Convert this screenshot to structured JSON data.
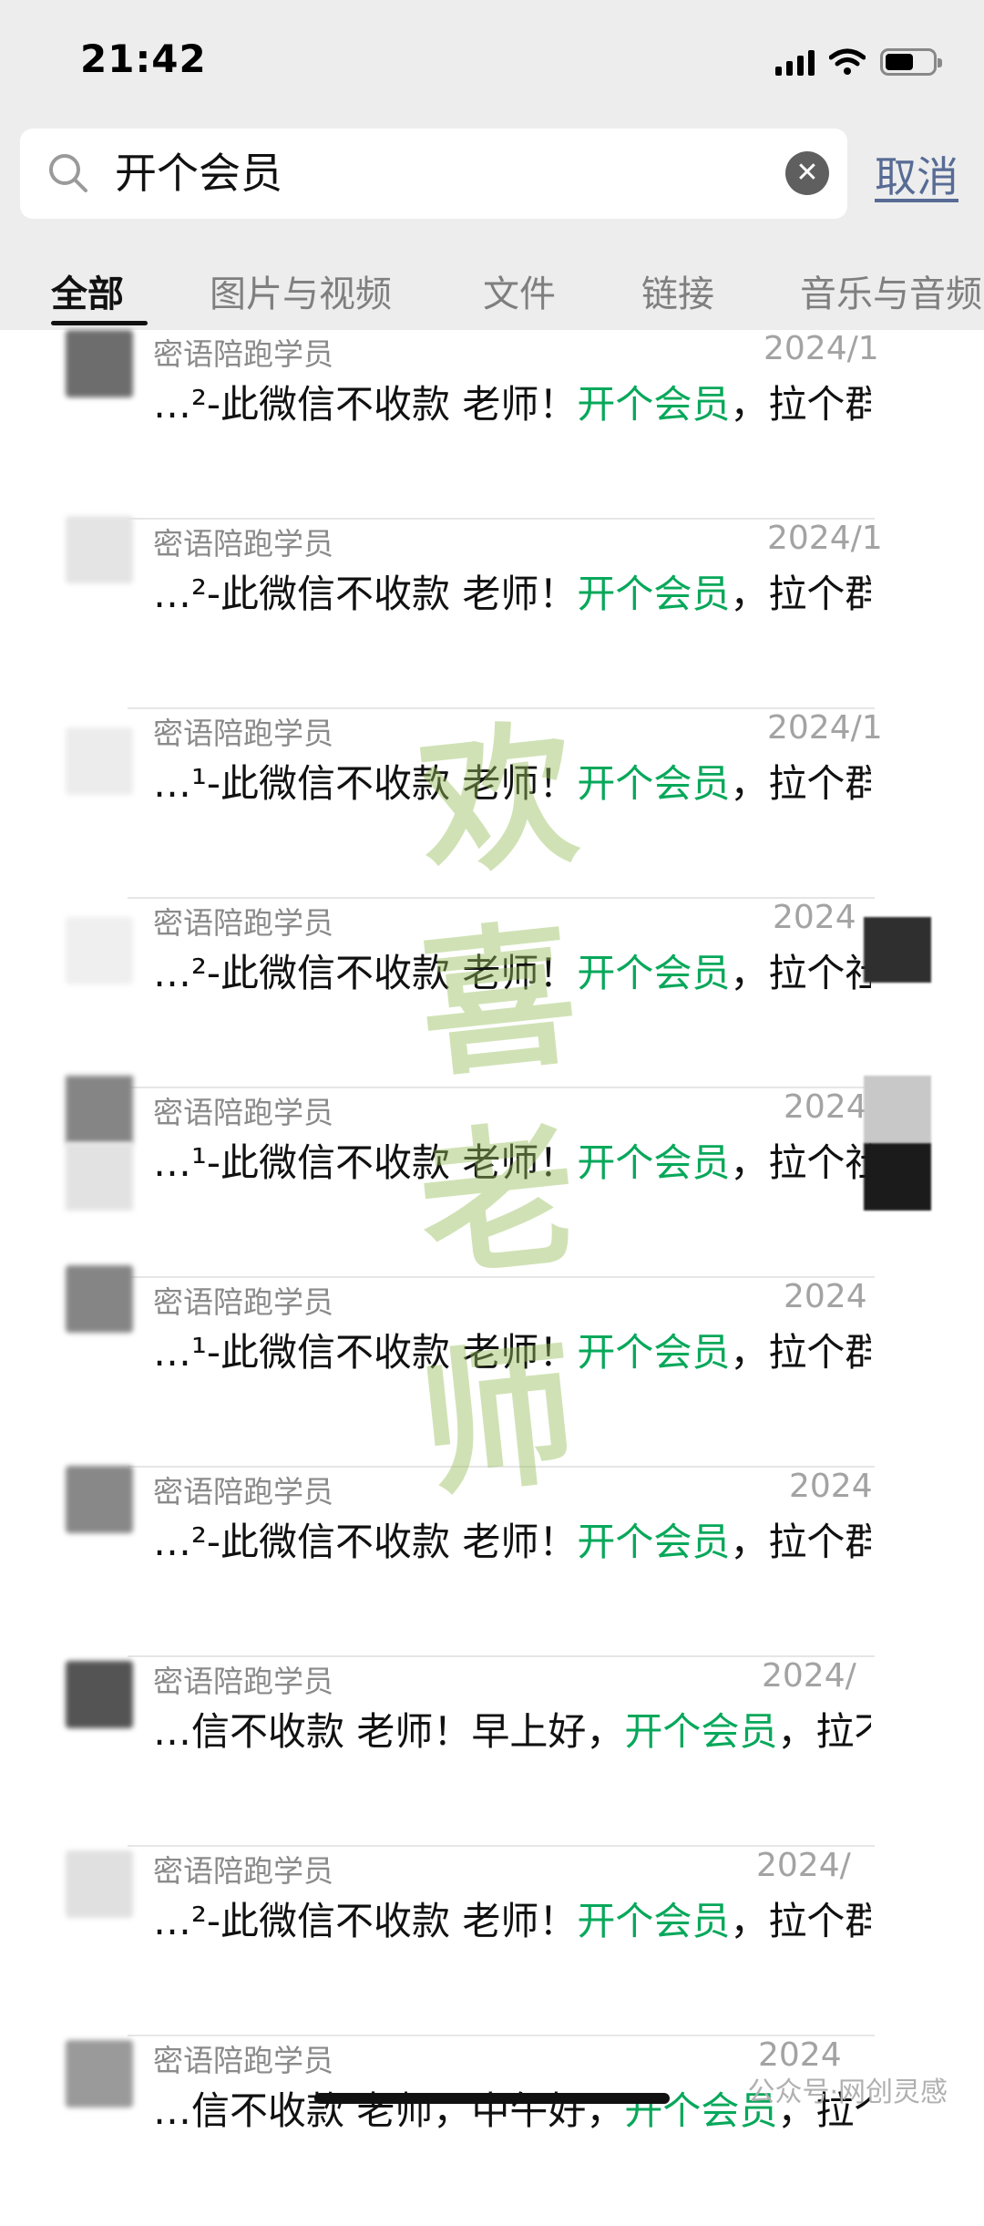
{
  "status_bar": {
    "time": "21:42"
  },
  "search": {
    "query": "开个会员",
    "cancel": "取消"
  },
  "tabs": [
    "全部",
    "图片与视频",
    "文件",
    "链接",
    "音乐与音频"
  ],
  "results": [
    {
      "name": "密语陪跑学员",
      "date": "2024/1",
      "pre": "…²-此微信不收款 老师！",
      "hl": "开个会员",
      "post": "，拉个群"
    },
    {
      "name": "密语陪跑学员",
      "date": "2024/1",
      "pre": "…²-此微信不收款 老师！",
      "hl": "开个会员",
      "post": "，拉个群"
    },
    {
      "name": "密语陪跑学员",
      "date": "2024/1",
      "pre": "…¹-此微信不收款 老师！",
      "hl": "开个会员",
      "post": "，拉个群"
    },
    {
      "name": "密语陪跑学员",
      "date": "2024",
      "pre": "…²-此微信不收款 老师！",
      "hl": "开个会员",
      "post": "，拉个社"
    },
    {
      "name": "密语陪跑学员",
      "date": "2024",
      "pre": "…¹-此微信不收款 老师！",
      "hl": "开个会员",
      "post": "，拉个社"
    },
    {
      "name": "密语陪跑学员",
      "date": "2024",
      "pre": "…¹-此微信不收款 老师！",
      "hl": "开个会员",
      "post": "，拉个群"
    },
    {
      "name": "密语陪跑学员",
      "date": "2024",
      "pre": "…²-此微信不收款 老师！",
      "hl": "开个会员",
      "post": "，拉个群"
    },
    {
      "name": "密语陪跑学员",
      "date": "2024/",
      "pre": "…信不收款 老师！早上好，",
      "hl": "开个会员",
      "post": "，拉不"
    },
    {
      "name": "密语陪跑学员",
      "date": "2024/",
      "pre": "…²-此微信不收款 老师！",
      "hl": "开个会员",
      "post": "，拉个群"
    },
    {
      "name": "密语陪跑学员",
      "date": "2024",
      "pre": "…信不收款 老师，中午好，",
      "hl": "开个会员",
      "post": "，拉个群"
    }
  ],
  "watermark": [
    "欢",
    "喜",
    "老",
    "师"
  ],
  "credit": "公众号·网创灵感",
  "colors": {
    "highlight": "#07a85a",
    "link": "#576b95",
    "topbar": "#ededed"
  }
}
